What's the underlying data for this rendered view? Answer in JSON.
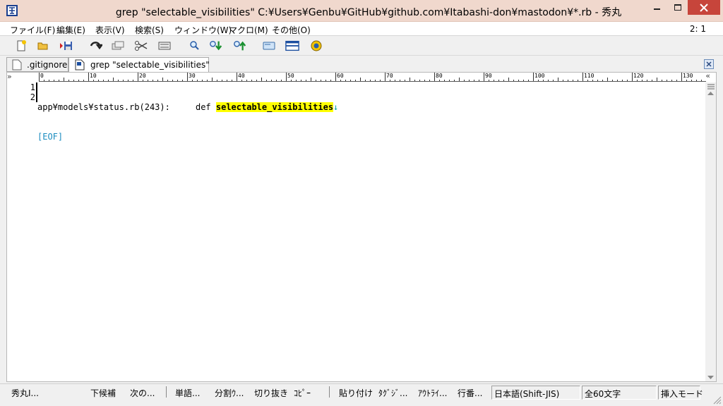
{
  "window": {
    "title": "grep \"selectable_visibilities\" C:¥Users¥Genbu¥GitHub¥github.com¥Itabashi-don¥mastodon¥*.rb - 秀丸"
  },
  "menu": {
    "items": [
      "ファイル(F)",
      "編集(E)",
      "表示(V)",
      "検索(S)",
      "ウィンドウ(W)",
      "マクロ(M)",
      "その他(O)"
    ],
    "cursor_position": "2: 1"
  },
  "toolbar": {
    "icons": [
      "new-file-icon",
      "open-folder-icon",
      "save-icon",
      "undo-icon",
      "copy-icon",
      "cut-icon",
      "paste-icon",
      "search-icon",
      "search-down-icon",
      "search-up-icon",
      "grep-icon",
      "window-split-icon",
      "macro-icon"
    ]
  },
  "tabs": [
    {
      "label": ".gitignore",
      "active": false
    },
    {
      "label": "grep \"selectable_visibilities\"",
      "active": true
    }
  ],
  "ruler": {
    "numbers": [
      "0",
      "10",
      "20",
      "30",
      "40",
      "50",
      "60",
      "70",
      "80",
      "90",
      "100",
      "110",
      "120",
      "130"
    ],
    "left_marker": "»",
    "right_marker": "«"
  },
  "editor": {
    "lines": [
      {
        "number": "1",
        "prefix": "app¥models¥status.rb(243):     def ",
        "match": "selectable_visibilities",
        "newline": "↓"
      },
      {
        "number": "2",
        "eof": "[EOF]"
      }
    ]
  },
  "statusbar": {
    "fkeys": [
      "秀丸I...",
      "下候補",
      "次の...",
      "単語...",
      "分割ｳ...",
      "切り抜き",
      "ｺﾋﾟｰ",
      "貼り付け",
      "ﾀｸﾞｼﾞ...",
      "ｱｳﾄﾗｲ...",
      "行番..."
    ],
    "encoding": "日本語(Shift-JIS)",
    "char_count": "全60文字",
    "mode": "挿入モード"
  },
  "colors": {
    "title_bg": "#f0d8cd",
    "close_btn": "#c7453b",
    "highlight": "#ffff00",
    "eof": "#1a8cc0"
  }
}
